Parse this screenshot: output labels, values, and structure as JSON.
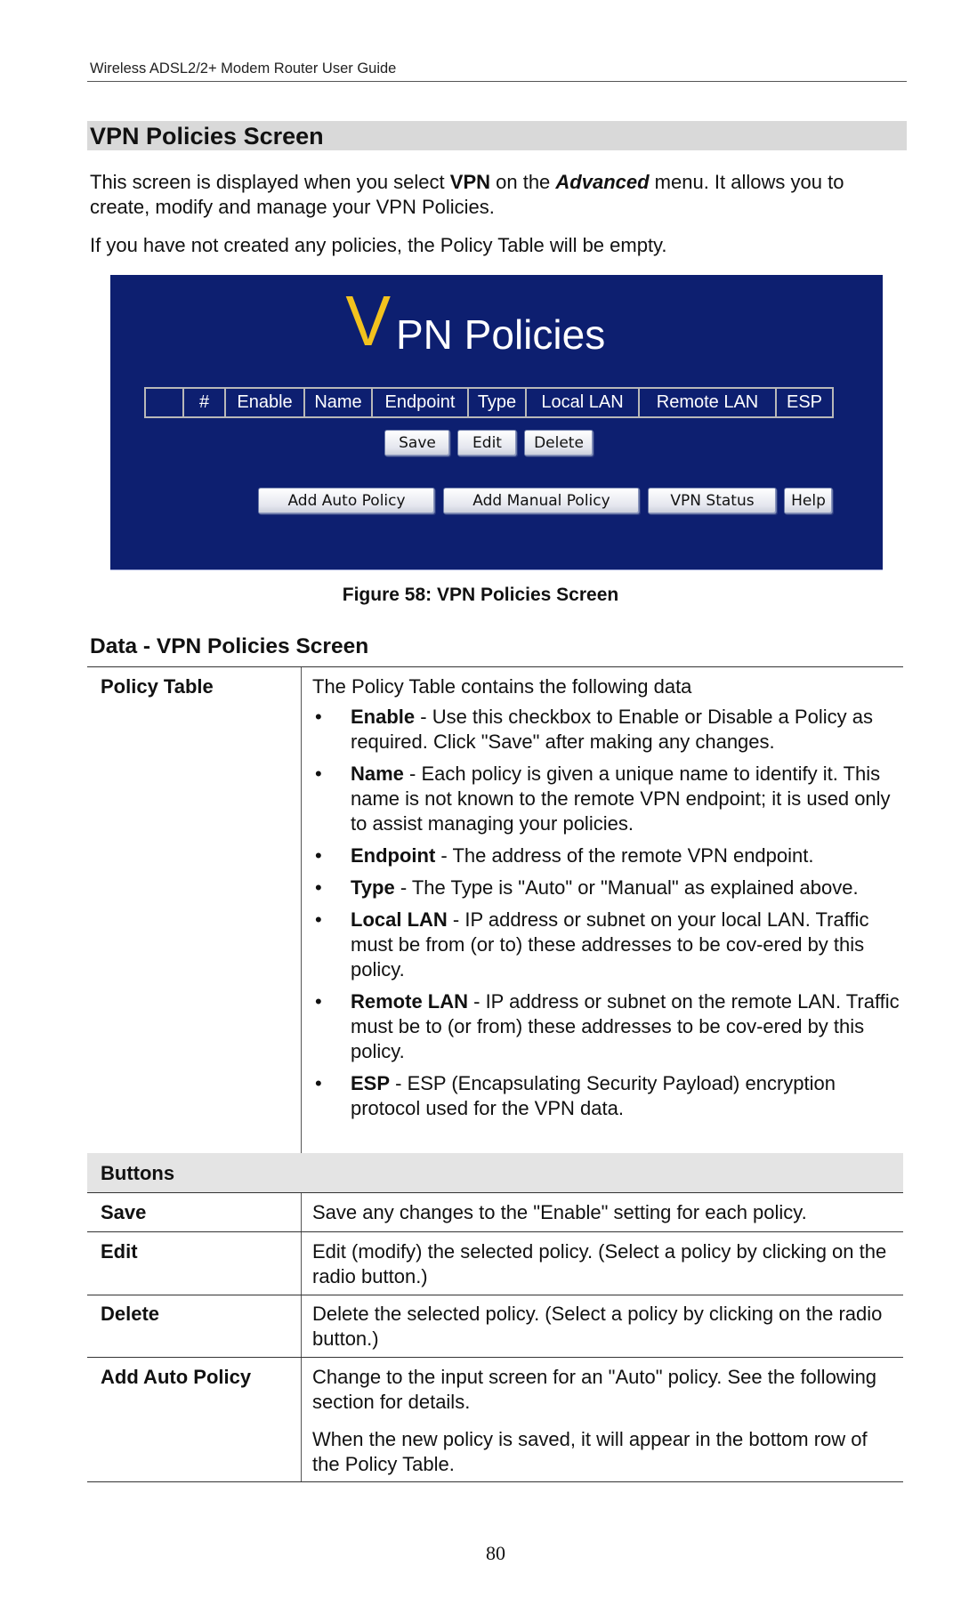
{
  "running_header": "Wireless ADSL2/2+ Modem Router User Guide",
  "section_title": "VPN Policies Screen",
  "intro": {
    "p1_before": "This screen is displayed when you select ",
    "p1_bold": "VPN",
    "p1_mid": " on the ",
    "p1_bold_italic": "Advanced",
    "p1_after": " menu. It allows you to create, modify and manage your VPN Policies.",
    "p2": "If you have not created any policies, the Policy Table will be empty."
  },
  "screenshot": {
    "title_initial": "V",
    "title_rest": "PN Policies",
    "colors": {
      "background": "#0d1f70",
      "title_initial": "#f2c21e",
      "text": "#ffffff"
    },
    "table_columns": [
      "",
      "#",
      "Enable",
      "Name",
      "Endpoint",
      "Type",
      "Local LAN",
      "Remote LAN",
      "ESP"
    ],
    "row_buttons": [
      "Save",
      "Edit",
      "Delete"
    ],
    "bottom_buttons": [
      "Add Auto Policy",
      "Add Manual Policy",
      "VPN Status",
      "Help"
    ]
  },
  "figure_caption": "Figure 58: VPN Policies Screen",
  "data_title": "Data - VPN Policies Screen",
  "data_table": {
    "policy_table": {
      "label": "Policy Table",
      "intro": "The Policy Table contains the following data",
      "bullets": [
        {
          "term": "Enable",
          "text": " - Use this checkbox to Enable or Disable a Policy as required. Click \"Save\" after making any changes."
        },
        {
          "term": "Name",
          "text": " - Each policy is given a unique name to identify it. This name is not known to the remote VPN endpoint; it is used only to assist managing your policies."
        },
        {
          "term": "Endpoint",
          "text": " - The address of the remote VPN endpoint."
        },
        {
          "term": "Type",
          "text": " - The Type is \"Auto\" or \"Manual\" as explained above."
        },
        {
          "term": "Local LAN",
          "text": " - IP address or subnet on your local LAN. Traffic must be from (or to) these addresses to be cov-ered by this policy."
        },
        {
          "term": "Remote LAN",
          "text": " - IP address or subnet on the remote LAN. Traffic must be to (or from) these addresses to be cov-ered by this policy."
        },
        {
          "term": "ESP",
          "text": " - ESP (Encapsulating Security Payload) encryption protocol used for the VPN data."
        }
      ]
    },
    "buttons_header": "Buttons",
    "rows": [
      {
        "label": "Save",
        "desc": [
          "Save any changes to the \"Enable\" setting for each policy."
        ]
      },
      {
        "label": "Edit",
        "desc": [
          "Edit (modify) the selected policy. (Select a policy by clicking on the radio button.)"
        ]
      },
      {
        "label": "Delete",
        "desc": [
          "Delete the selected policy. (Select a policy by clicking on the radio button.)"
        ]
      },
      {
        "label": "Add Auto Policy",
        "desc": [
          "Change to the input screen for an \"Auto\" policy. See the following section for details.",
          "When the new policy is saved, it will appear in the bottom row of the Policy Table."
        ]
      }
    ]
  },
  "page_number": "80"
}
